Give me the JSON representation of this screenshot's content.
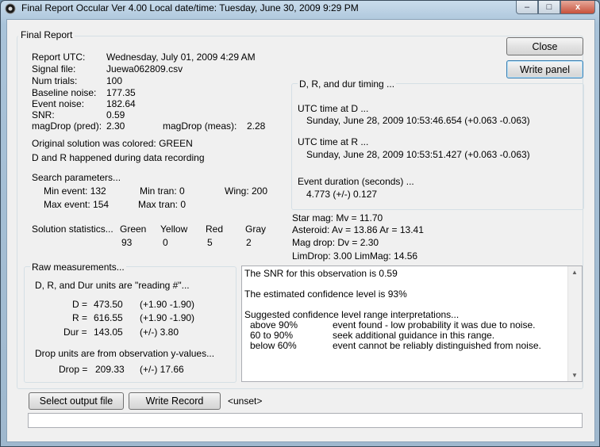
{
  "window": {
    "title": "Final Report Occular Ver 4.00  Local date/time:  Tuesday, June 30, 2009  9:29 PM"
  },
  "titlebar_buttons": {
    "minimize": "–",
    "maximize": "□",
    "close": "x"
  },
  "final_report_group": {
    "label": "Final Report"
  },
  "report": {
    "utc_label": "Report UTC:",
    "utc_value": "Wednesday, July 01, 2009 4:29 AM",
    "signal_file_label": "Signal file:",
    "signal_file_value": "Juewa062809.csv",
    "num_trials_label": "Num trials:",
    "num_trials_value": "100",
    "baseline_noise_label": "Baseline noise:",
    "baseline_noise_value": "177.35",
    "event_noise_label": "Event noise:",
    "event_noise_value": "182.64",
    "snr_label": "SNR:",
    "snr_value": "0.59",
    "magdrop_pred_label": "magDrop (pred):",
    "magdrop_pred_value": "2.30",
    "magdrop_meas_label": "magDrop (meas):",
    "magdrop_meas_value": "2.28",
    "solution_colored": "Original solution was colored:  GREEN",
    "dr_happened": "D and R happened during data recording"
  },
  "search": {
    "title": "Search parameters...",
    "min_event": "Min event: 132",
    "min_tran": "Min tran: 0",
    "wing": "Wing: 200",
    "max_event": "Max event: 154",
    "max_tran": "Max tran: 0"
  },
  "solution_stats": {
    "label": "Solution statistics...",
    "headers": [
      "Green",
      "Yellow",
      "Red",
      "Gray"
    ],
    "values": [
      "93",
      "0",
      "5",
      "2"
    ]
  },
  "timing": {
    "title": "D, R, and dur timing ...",
    "utc_d_label": "UTC time at D ...",
    "utc_d_value": "Sunday, June 28, 2009 10:53:46.654 (+0.063 -0.063)",
    "utc_r_label": "UTC time at R ...",
    "utc_r_value": "Sunday, June 28, 2009 10:53:51.427 (+0.063 -0.063)",
    "duration_label": "Event duration (seconds) ...",
    "duration_value": "4.773  (+/-)  0.127"
  },
  "star": {
    "star_mag": "Star mag: Mv = 11.70",
    "asteroid": "Asteroid:   Av = 13.86 Ar = 13.41",
    "mag_drop": "Mag drop:  Dv = 2.30",
    "lim": "LimDrop: 3.00  LimMag: 14.56"
  },
  "raw": {
    "title": "Raw measurements...",
    "units_note": "D, R, and Dur units are \"reading #\"...",
    "d_label": "D =",
    "d_value": "473.50",
    "d_err": "(+1.90 -1.90)",
    "r_label": "R =",
    "r_value": "616.55",
    "r_err": "(+1.90 -1.90)",
    "dur_label": "Dur =",
    "dur_value": "143.05",
    "dur_err": "(+/-)  3.80",
    "drop_note": "Drop units are from observation y-values...",
    "drop_label": "Drop =",
    "drop_value": "209.33",
    "drop_err": "(+/-)  17.66"
  },
  "memo": {
    "line1": "The SNR for this observation is 0.59",
    "line2": "The estimated confidence level is 93%",
    "line3": "Suggested confidence level range interpretations...",
    "row1_range": "above 90%",
    "row1_text": "event found - low probability it was due to noise.",
    "row2_range": "60 to 90%",
    "row2_text": "seek additional guidance in this range.",
    "row3_range": "below 60%",
    "row3_text": "event cannot be reliably distinguished from noise."
  },
  "buttons": {
    "close": "Close",
    "write_panel": "Write panel",
    "select_output": "Select output file",
    "write_record": "Write Record"
  },
  "output_file": "<unset>",
  "status_text": ""
}
